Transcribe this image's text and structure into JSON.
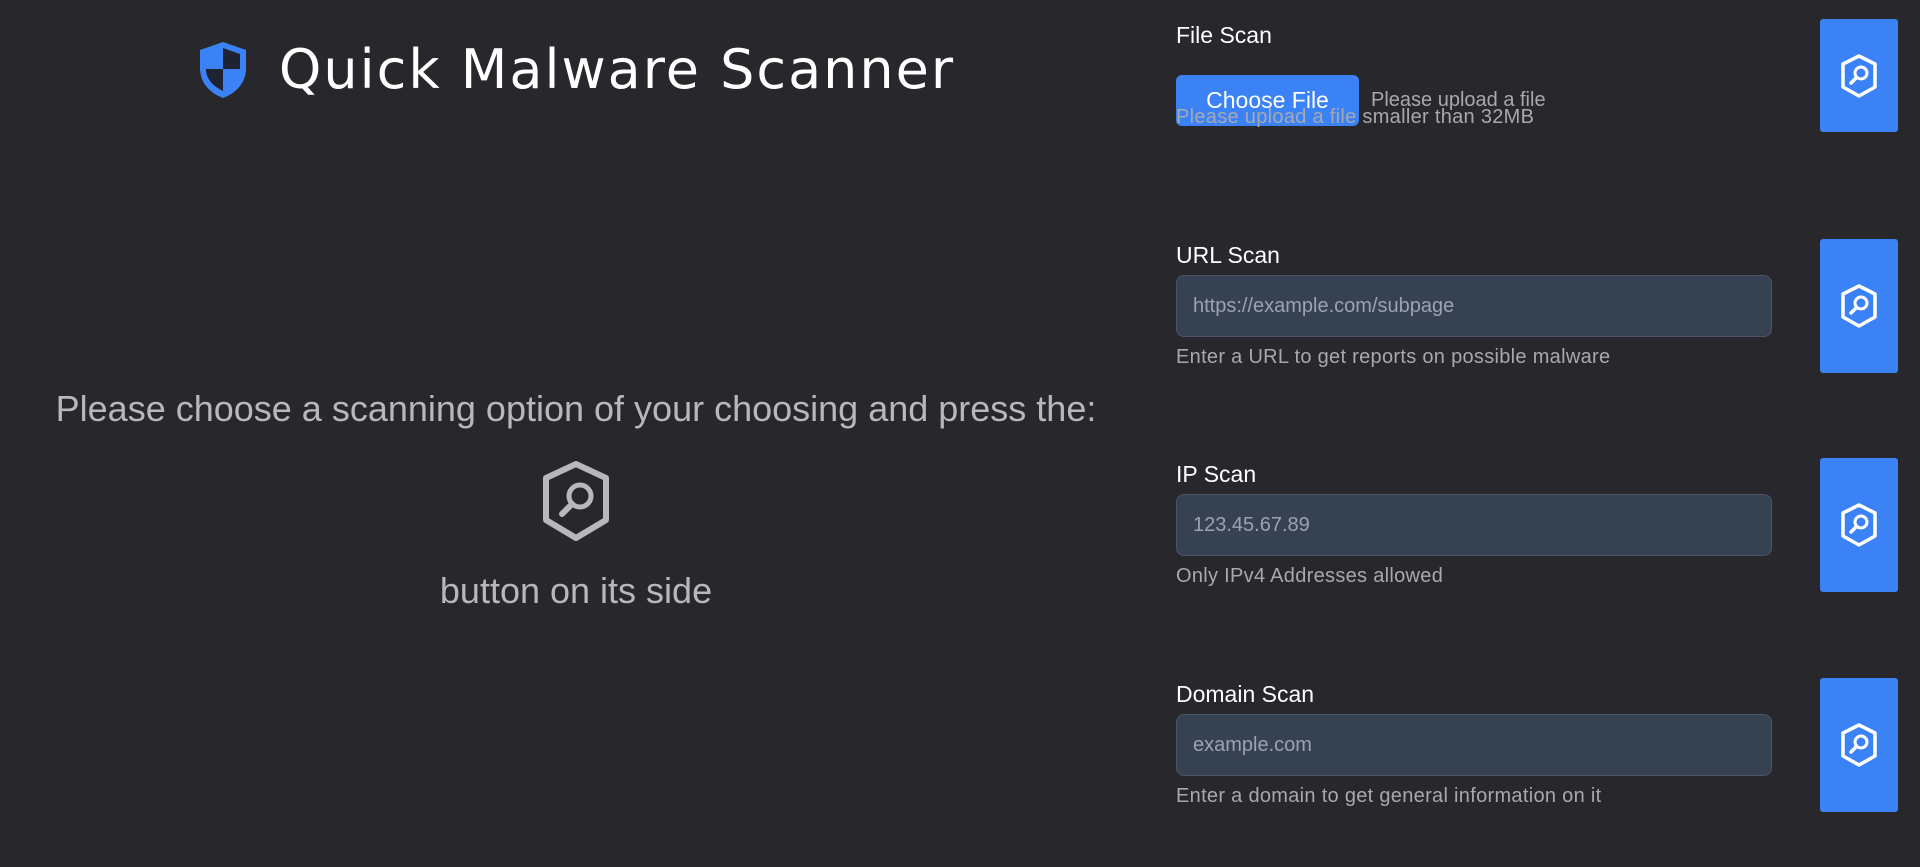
{
  "brand": {
    "title": "Quick Malware Scanner",
    "logo_icon": "shield-icon",
    "logo_color": "#3b82f6"
  },
  "instructions": {
    "line1": "Please choose a scanning option of your choosing and press the:",
    "icon": "shield-search-icon",
    "line2": "button on its side"
  },
  "file_scan": {
    "label": "File Scan",
    "choose_button": "Choose File",
    "status": "Please upload a file",
    "help": "Please upload a file smaller than 32MB",
    "scan_icon": "shield-search-icon"
  },
  "url_scan": {
    "label": "URL Scan",
    "placeholder": "https://example.com/subpage",
    "help": "Enter a URL to get reports on possible malware",
    "scan_icon": "shield-search-icon"
  },
  "ip_scan": {
    "label": "IP Scan",
    "placeholder": "123.45.67.89",
    "help": "Only IPv4 Addresses allowed",
    "scan_icon": "shield-search-icon"
  },
  "domain_scan": {
    "label": "Domain Scan",
    "placeholder": "example.com",
    "help": "Enter a domain to get general information on it",
    "scan_icon": "shield-search-icon"
  },
  "colors": {
    "background": "#27272c",
    "accent": "#3b82f6",
    "input_bg": "#364152"
  }
}
